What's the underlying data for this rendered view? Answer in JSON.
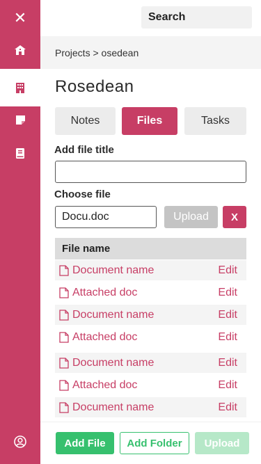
{
  "sidebar": {
    "items": [
      {
        "icon": "close-icon"
      },
      {
        "icon": "home-icon"
      },
      {
        "icon": "building-icon"
      },
      {
        "icon": "note-icon"
      },
      {
        "icon": "book-icon"
      },
      {
        "icon": "user-icon"
      }
    ],
    "close_glyph": "✕"
  },
  "search": {
    "label": "Search"
  },
  "breadcrumb": {
    "text": "Projects > osedean"
  },
  "page": {
    "title": "Rosedean"
  },
  "tabs": [
    {
      "label": "Notes"
    },
    {
      "label": "Files"
    },
    {
      "label": "Tasks"
    }
  ],
  "form": {
    "title_label": "Add file title",
    "title_value": "",
    "choose_label": "Choose file",
    "file_value": "Docu.doc",
    "upload_label": "Upload",
    "clear_label": "X"
  },
  "table": {
    "header": "File name",
    "rows": [
      {
        "name": "Document name",
        "action": "Edit"
      },
      {
        "name": "Attached doc",
        "action": "Edit"
      },
      {
        "name": "Document name",
        "action": "Edit"
      },
      {
        "name": "Attached doc",
        "action": "Edit"
      },
      {
        "name": "Document name",
        "action": "Edit"
      },
      {
        "name": "Attached doc",
        "action": "Edit"
      },
      {
        "name": "Document name",
        "action": "Edit"
      }
    ]
  },
  "actions": {
    "add_file": "Add File",
    "add_folder": "Add Folder",
    "upload": "Upload"
  },
  "colors": {
    "accent": "#c73e65",
    "success": "#36c06e"
  }
}
